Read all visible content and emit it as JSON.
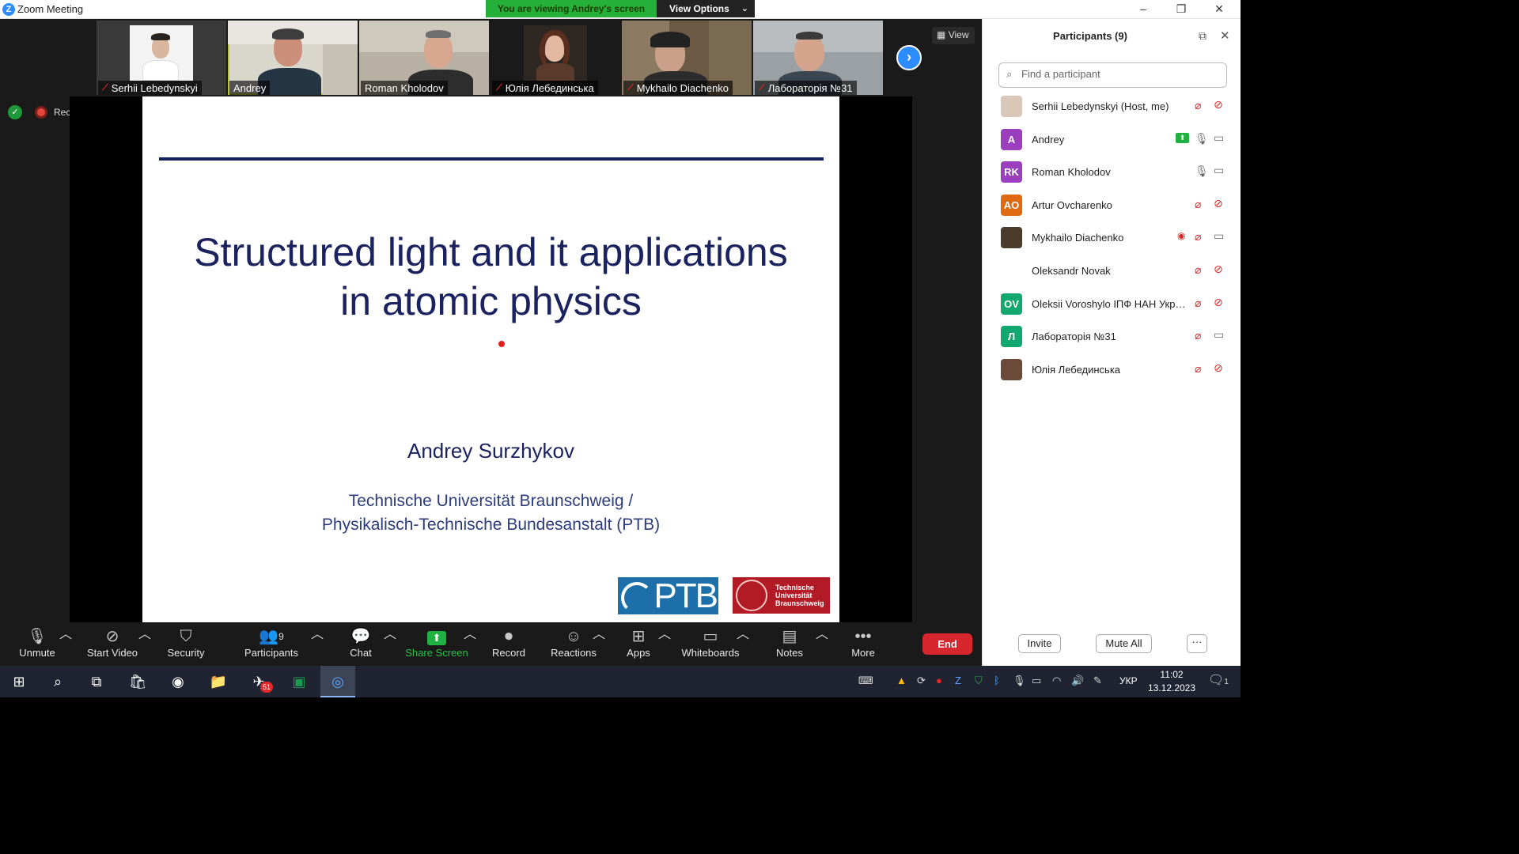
{
  "window": {
    "title": "Zoom Meeting",
    "minimize": "–",
    "restore": "❐",
    "close": "✕"
  },
  "banner": {
    "viewing": "You are viewing Andrey's screen",
    "options": "View Options",
    "chevron": "⌄"
  },
  "gallery": {
    "view_label": "View",
    "next_icon": "chevron-right",
    "tiles": [
      {
        "name": "Serhii Lebedynskyi",
        "muted": true
      },
      {
        "name": "Andrey",
        "muted": false,
        "active": true
      },
      {
        "name": "Roman Kholodov",
        "muted": false
      },
      {
        "name": "Юлія Лебединська",
        "muted": true
      },
      {
        "name": "Mykhailo Diachenko",
        "muted": true
      },
      {
        "name": "Лабораторія №31",
        "muted": true
      }
    ]
  },
  "recording": {
    "label": "Recording"
  },
  "slide": {
    "title_line1": "Structured light and it applications",
    "title_line2": "in atomic physics",
    "author": "Andrey Surzhykov",
    "affiliation_line1": "Technische Universität Braunschweig /",
    "affiliation_line2": "Physikalisch-Technische Bundesanstalt (PTB)",
    "logo_ptb": "PTB",
    "logo_tubs_line1": "Technische",
    "logo_tubs_line2": "Universität",
    "logo_tubs_line3": "Braunschweig"
  },
  "toolbar": {
    "unmute": "Unmute",
    "start_video": "Start Video",
    "security": "Security",
    "participants": "Participants",
    "participants_count": "9",
    "chat": "Chat",
    "share_screen": "Share Screen",
    "record": "Record",
    "reactions": "Reactions",
    "apps": "Apps",
    "whiteboards": "Whiteboards",
    "notes": "Notes",
    "more": "More",
    "end": "End"
  },
  "panel": {
    "title": "Participants (9)",
    "search_placeholder": "Find a participant",
    "participants": [
      {
        "name": "Serhii Lebedynskyi (Host, me)",
        "avatar": "",
        "avatar_color": "#d9c7b8",
        "mic": "muted",
        "cam": "off"
      },
      {
        "name": "Andrey",
        "avatar": "A",
        "avatar_color": "#9b3fbf",
        "mic": "on",
        "cam": "on",
        "sharing": true
      },
      {
        "name": "Roman Kholodov",
        "avatar": "RK",
        "avatar_color": "#9b3fbf",
        "mic": "on",
        "cam": "on"
      },
      {
        "name": "Artur Ovcharenko",
        "avatar": "AO",
        "avatar_color": "#e06a12",
        "mic": "muted",
        "cam": "off"
      },
      {
        "name": "Mykhailo Diachenko",
        "avatar": "",
        "avatar_color": "#4a3b2d",
        "mic": "muted",
        "cam": "on",
        "recording": true
      },
      {
        "name": "Oleksandr Novak",
        "avatar": "",
        "avatar_color": "#ffffff",
        "mic": "muted",
        "cam": "off"
      },
      {
        "name": "Oleksii Voroshylo ІПФ НАН Украї...",
        "avatar": "OV",
        "avatar_color": "#13a86f",
        "mic": "muted",
        "cam": "off"
      },
      {
        "name": "Лабораторія №31",
        "avatar": "Л",
        "avatar_color": "#13a86f",
        "mic": "muted",
        "cam": "on"
      },
      {
        "name": "Юлія Лебединська",
        "avatar": "",
        "avatar_color": "#6b4a3a",
        "mic": "muted",
        "cam": "off"
      }
    ],
    "invite": "Invite",
    "mute_all": "Mute All",
    "more": "···"
  },
  "taskbar": {
    "language": "УКР",
    "time": "11:02",
    "date": "13.12.2023",
    "telegram_badge": "51",
    "notification_count": "1"
  }
}
